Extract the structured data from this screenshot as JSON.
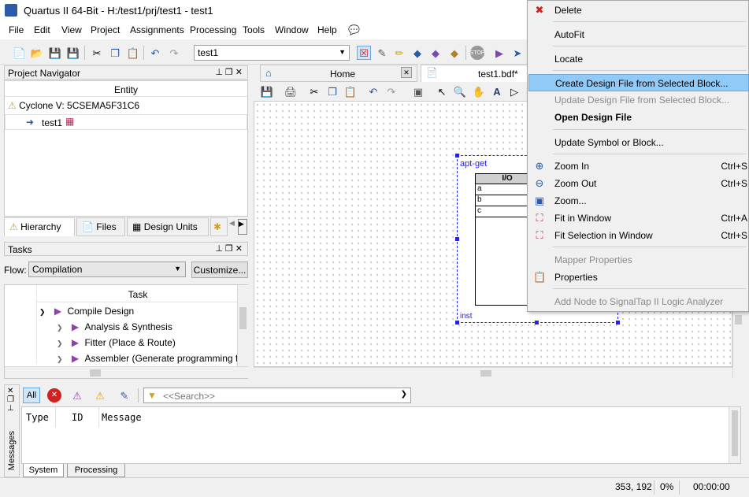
{
  "window": {
    "title": "Quartus II 64-Bit - H:/test1/prj/test1 - test1"
  },
  "menu": [
    "File",
    "Edit",
    "View",
    "Project",
    "Assignments",
    "Processing",
    "Tools",
    "Window",
    "Help"
  ],
  "toolbar": {
    "project_combo": "test1"
  },
  "project_navigator": {
    "title": "Project Navigator",
    "column_header": "Entity",
    "device": "Cyclone V: 5CSEMA5F31C6",
    "entity": "test1",
    "tabs": [
      "Hierarchy",
      "Files",
      "Design Units"
    ]
  },
  "tasks": {
    "title": "Tasks",
    "flow_label": "Flow:",
    "flow_value": "Compilation",
    "customize_label": "Customize...",
    "column_header": "Task",
    "items": [
      "Compile Design",
      "Analysis & Synthesis",
      "Fitter (Place & Route)",
      "Assembler (Generate programming files)"
    ]
  },
  "editor_tabs": {
    "home": "Home",
    "file": "test1.bdf*"
  },
  "block": {
    "name": "apt-get",
    "header": "I/O",
    "ports": [
      "a",
      "b",
      "c"
    ],
    "instance": "inst"
  },
  "context_menu": {
    "items": [
      {
        "label": "Delete",
        "shortcut": "",
        "icon": "delete-x-icon"
      },
      {
        "label": "AutoFit",
        "shortcut": ""
      },
      {
        "label": "Locate",
        "shortcut": ""
      },
      {
        "label": "Create Design File from Selected Block...",
        "shortcut": ""
      },
      {
        "label": "Update Design File from Selected Block...",
        "shortcut": ""
      },
      {
        "label": "Open Design File",
        "shortcut": ""
      },
      {
        "label": "Update Symbol or Block...",
        "shortcut": ""
      },
      {
        "label": "Zoom In",
        "shortcut": "Ctrl+S",
        "icon": "zoom-in-icon"
      },
      {
        "label": "Zoom Out",
        "shortcut": "Ctrl+S",
        "icon": "zoom-out-icon"
      },
      {
        "label": "Zoom...",
        "shortcut": "",
        "icon": "zoom-icon"
      },
      {
        "label": "Fit in Window",
        "shortcut": "Ctrl+A",
        "icon": "fit-window-icon"
      },
      {
        "label": "Fit Selection in Window",
        "shortcut": "Ctrl+S",
        "icon": "fit-selection-icon"
      },
      {
        "label": "Mapper Properties",
        "shortcut": ""
      },
      {
        "label": "Properties",
        "shortcut": "",
        "icon": "properties-icon"
      },
      {
        "label": "Add Node to SignalTap II Logic Analyzer",
        "shortcut": ""
      }
    ]
  },
  "messages": {
    "side_label": "Messages",
    "filter_all": "All",
    "search_placeholder": "<<Search>>",
    "columns": [
      "Type",
      "ID",
      "Message"
    ],
    "tabs": [
      "System",
      "Processing"
    ]
  },
  "status": {
    "coords": "353, 192",
    "progress": "0%",
    "time": "00:00:00"
  },
  "colors": {
    "highlight": "#91c9f7",
    "selection_blue": "#0000ff",
    "accent": "#2a5ba8"
  }
}
